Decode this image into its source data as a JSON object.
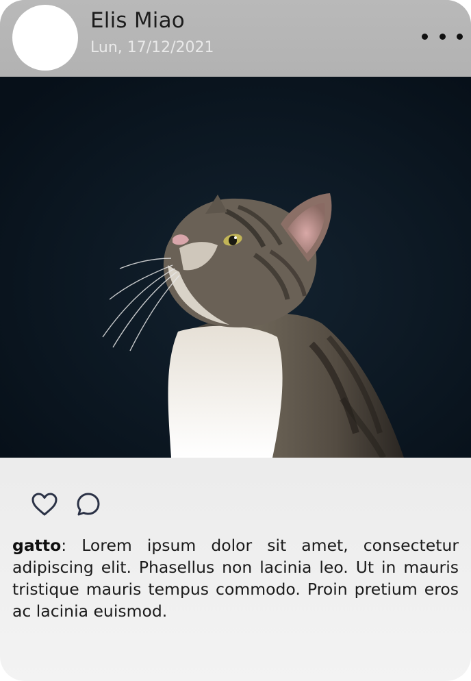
{
  "post": {
    "author_name": "Elis Miao",
    "date": "Lun, 17/12/2021",
    "avatar_icon": "avatar-placeholder",
    "more_icon": "more-horizontal-icon",
    "image_icon": "cat-photo",
    "actions": {
      "like_icon": "heart-icon",
      "comment_icon": "comment-bubble-icon"
    },
    "caption_user": "gatto",
    "caption_separator": ":",
    "caption_text": " Lorem ipsum dolor sit amet, consectetur adipiscing elit. Phasellus non lacinia leo. Ut in mauris tristique mauris tempus commodo. Proin pretium eros ac lacinia euismod."
  },
  "colors": {
    "header_bg": "#b5b5b5",
    "photo_bg": "#0b1622",
    "icon_color": "#2b3246",
    "text_color": "#1b1b1b",
    "date_color": "#e9e9e9"
  }
}
